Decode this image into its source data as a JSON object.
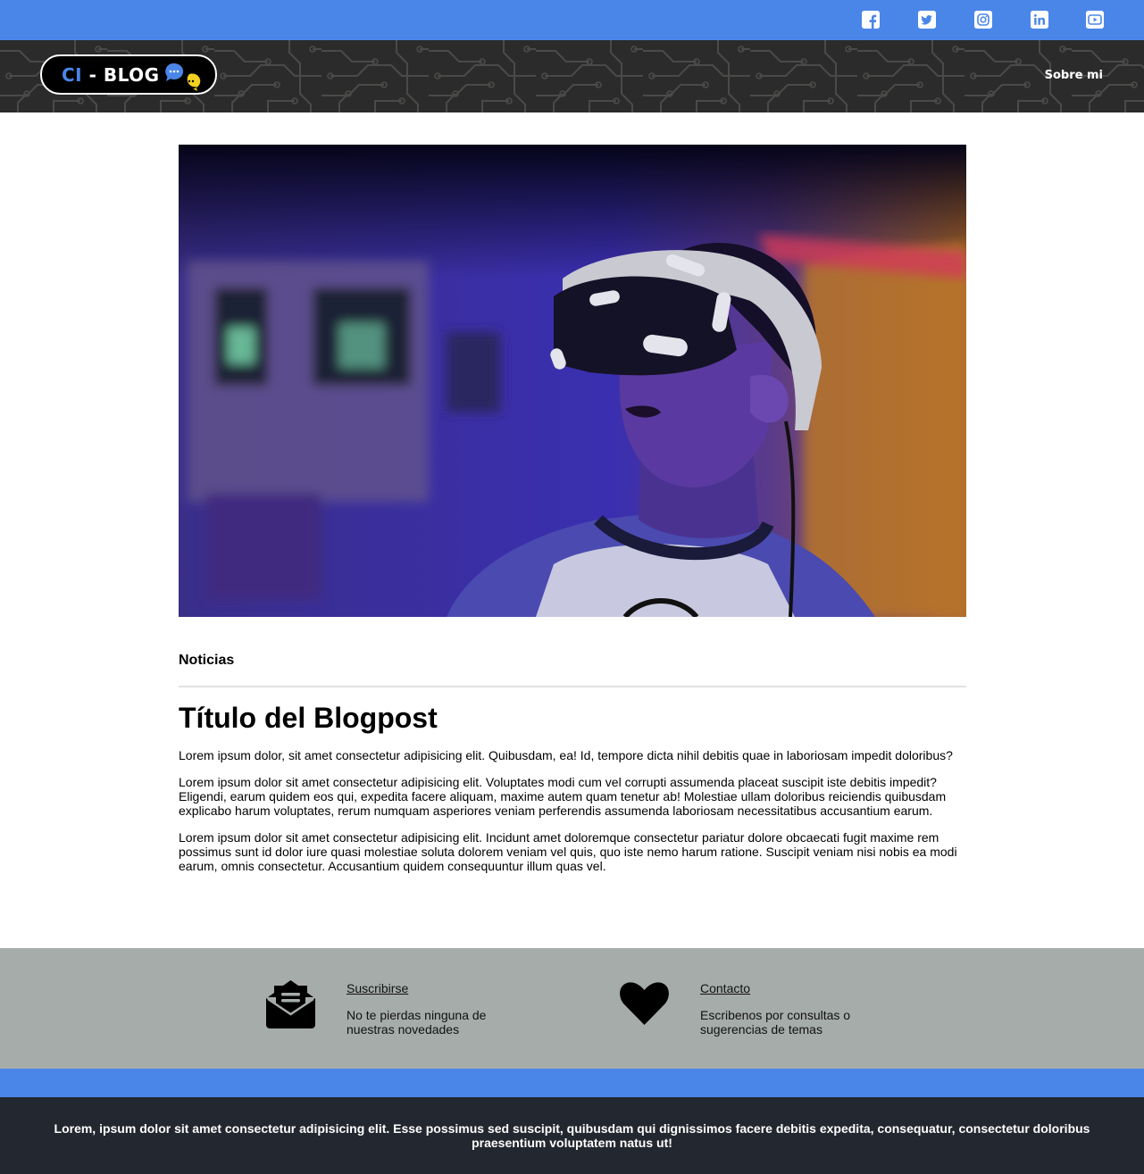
{
  "topbar": {
    "social": [
      "facebook-icon",
      "twitter-icon",
      "instagram-icon",
      "linkedin-icon",
      "youtube-icon"
    ],
    "color": "#4a86e8"
  },
  "header": {
    "logo": {
      "prefix": "CI",
      "suffix": " - BLOG"
    },
    "nav_about": "Sobre mi",
    "background": "#2b2b2b"
  },
  "hero": {
    "icon": "vr-headset-photo"
  },
  "article": {
    "category": "Noticias",
    "title": "Título del Blogpost",
    "paragraphs": [
      "Lorem ipsum dolor, sit amet consectetur adipisicing elit. Quibusdam, ea! Id, tempore dicta nihil debitis quae in laboriosam impedit doloribus?",
      "Lorem ipsum dolor sit amet consectetur adipisicing elit. Voluptates modi cum vel corrupti assumenda placeat suscipit iste debitis impedit? Eligendi, earum quidem eos qui, expedita facere aliquam, maxime autem quam tenetur ab! Molestiae ullam doloribus reiciendis quibusdam explicabo harum voluptates, rerum numquam asperiores veniam perferendis assumenda laboriosam necessitatibus accusantium earum.",
      "Lorem ipsum dolor sit amet consectetur adipisicing elit. Incidunt amet doloremque consectetur pariatur dolore obcaecati fugit maxime rem possimus sunt id dolor iure quasi molestiae soluta dolorem veniam vel quis, quo iste nemo harum ratione. Suscipit veniam nisi nobis ea modi earum, omnis consectetur. Accusantium quidem consequuntur illum quas vel."
    ]
  },
  "footer": {
    "subscribe": {
      "link": "Suscribirse",
      "text": "No te pierdas ninguna de nuestras novedades",
      "icon": "envelope-open-icon"
    },
    "contact": {
      "link": "Contacto",
      "text": "Escribenos por consultas o sugerencias de temas",
      "icon": "heart-icon"
    },
    "bottom_text": "Lorem, ipsum dolor sit amet consectetur adipisicing elit. Esse possimus sed suscipit, quibusdam qui dignissimos facere debitis expedita, consequatur, consectetur doloribus praesentium voluptatem natus ut!"
  }
}
